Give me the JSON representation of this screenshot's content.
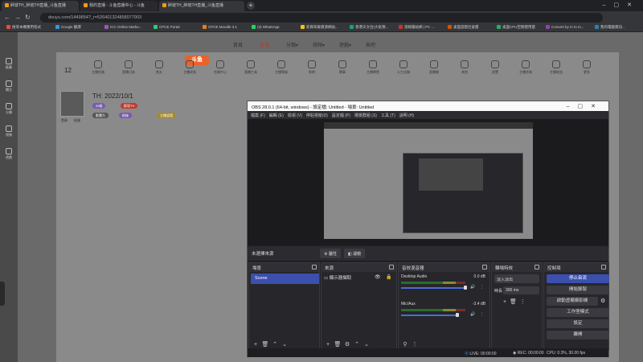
{
  "browser": {
    "tabs": [
      "醉琥TH_醉琥TH直播_斗鱼直播",
      "我的直播 - 斗鱼直播中心 - 斗鱼",
      "醉琥TH_醉琥TH直播_斗鱼直播"
    ],
    "url": "douyu.com/1449854?_r=526401324858077903",
    "bookmarks": [
      "搜尋本機應用程式",
      "Google 翻譯",
      "ICC Online Marke...",
      "CPCE Portal",
      "CPCE Moodle 3.1",
      "(3) WhatsApp",
      "新興布藝資源網站...",
      "香港天文台(大氣預...",
      "澳媒鐵站網 | PC ...",
      "桌面遊戲社會團",
      "桌面CPU空間使用量",
      "Convert by m to m...",
      "我的電腦資訊..."
    ]
  },
  "site": {
    "leftnav": [
      "推薦",
      "關注",
      "分類",
      "視頻",
      "遊戲"
    ],
    "logo": "斗鱼",
    "nav": [
      "首頁",
      "直播",
      "分類▾",
      "視頻▾",
      "遊戲▾",
      "魚吧"
    ],
    "icons": [
      "主播任務",
      "直播日誌",
      "魚丸",
      "主播成長",
      "任務中心",
      "直播工具",
      "主播等級",
      "魚吧",
      "賽事",
      "主播學院",
      "火力全開",
      "直播間",
      "其他",
      "設置",
      "主播任務",
      "主播收益",
      "更多"
    ],
    "count": "12",
    "page_title": "TH: 2022/10/1",
    "profile_labels": [
      "首頁",
      "紀錄"
    ],
    "pills": [
      "99級",
      "醉琥TH",
      "影響力",
      "粉絲",
      "主播認證"
    ]
  },
  "obs": {
    "title": "OBS 28.0.1 (64-bit, windows) - 設定檔: Untitled - 場景: Untitled",
    "menu": [
      "檔案 (F)",
      "編輯 (E)",
      "檢視 (V)",
      "停駐視窗(D)",
      "設定檔 (P)",
      "場景群組 (S)",
      "工具 (T)",
      "說明 (H)"
    ],
    "no_source": "未選擇來源",
    "properties_label": "屬性",
    "filters_label": "濾鏡",
    "docks": {
      "scenes": "場景",
      "sources": "來源",
      "mixer": "音效混音器",
      "transitions": "轉場特效",
      "controls": "控制項"
    },
    "scene_item": "Scene",
    "source_item": "顯示器擷取",
    "mixer": [
      {
        "name": "Desktop Audio",
        "db": "0.0 dB"
      },
      {
        "name": "Mic/Aux",
        "db": "-3.4 dB"
      }
    ],
    "transition": "淡入淡出",
    "duration_label": "時長",
    "duration": "300 ms",
    "controls": [
      "停止串流",
      "開始錄製",
      "啟動虛擬攝影機",
      "工作室模式",
      "設定",
      "離開"
    ],
    "status": {
      "live": "LIVE: 00:00:00",
      "rec": "REC: 00:00:00",
      "cpu": "CPU: 0.3%, 30.00 fps"
    }
  }
}
